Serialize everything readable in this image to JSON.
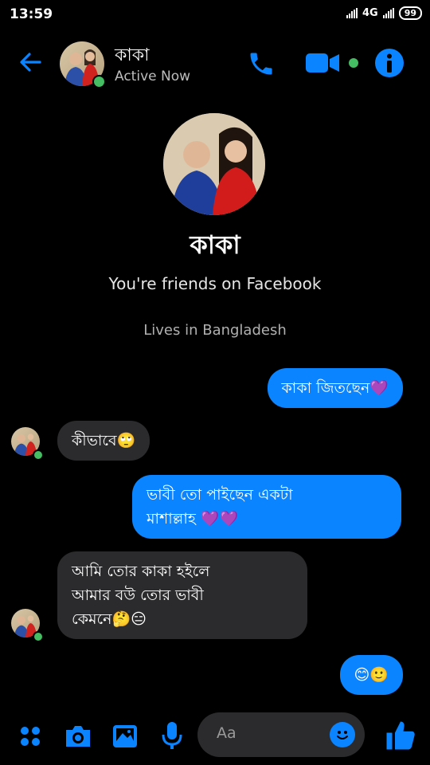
{
  "status_bar": {
    "time": "13:59",
    "network": "4G",
    "battery": "99"
  },
  "header": {
    "name": "কাকা",
    "status": "Active Now"
  },
  "profile": {
    "name": "কাকা",
    "friends_text": "You're friends on Facebook",
    "location_text": "Lives in Bangladesh"
  },
  "messages": [
    {
      "from": "me",
      "text": "কাকা জিতছেন💜"
    },
    {
      "from": "them",
      "text": "কীভাবে🙄"
    },
    {
      "from": "me",
      "line1": "ভাবী তো পাইছেন একটা",
      "line2": "মাশাল্লাহ 💜💜"
    },
    {
      "from": "them",
      "line1": "আমি তোর কাকা হইলে",
      "line2": "আমার বউ তোর ভাবী",
      "line3": "কেমনে🤔😑"
    },
    {
      "from": "me",
      "text": "😊🙂"
    }
  ],
  "composer": {
    "placeholder": "Aa"
  },
  "colors": {
    "accent": "#0a84ff",
    "sent_bubble": "#0a84ff",
    "received_bubble": "#2b2b2d",
    "active_dot": "#45bd62"
  }
}
